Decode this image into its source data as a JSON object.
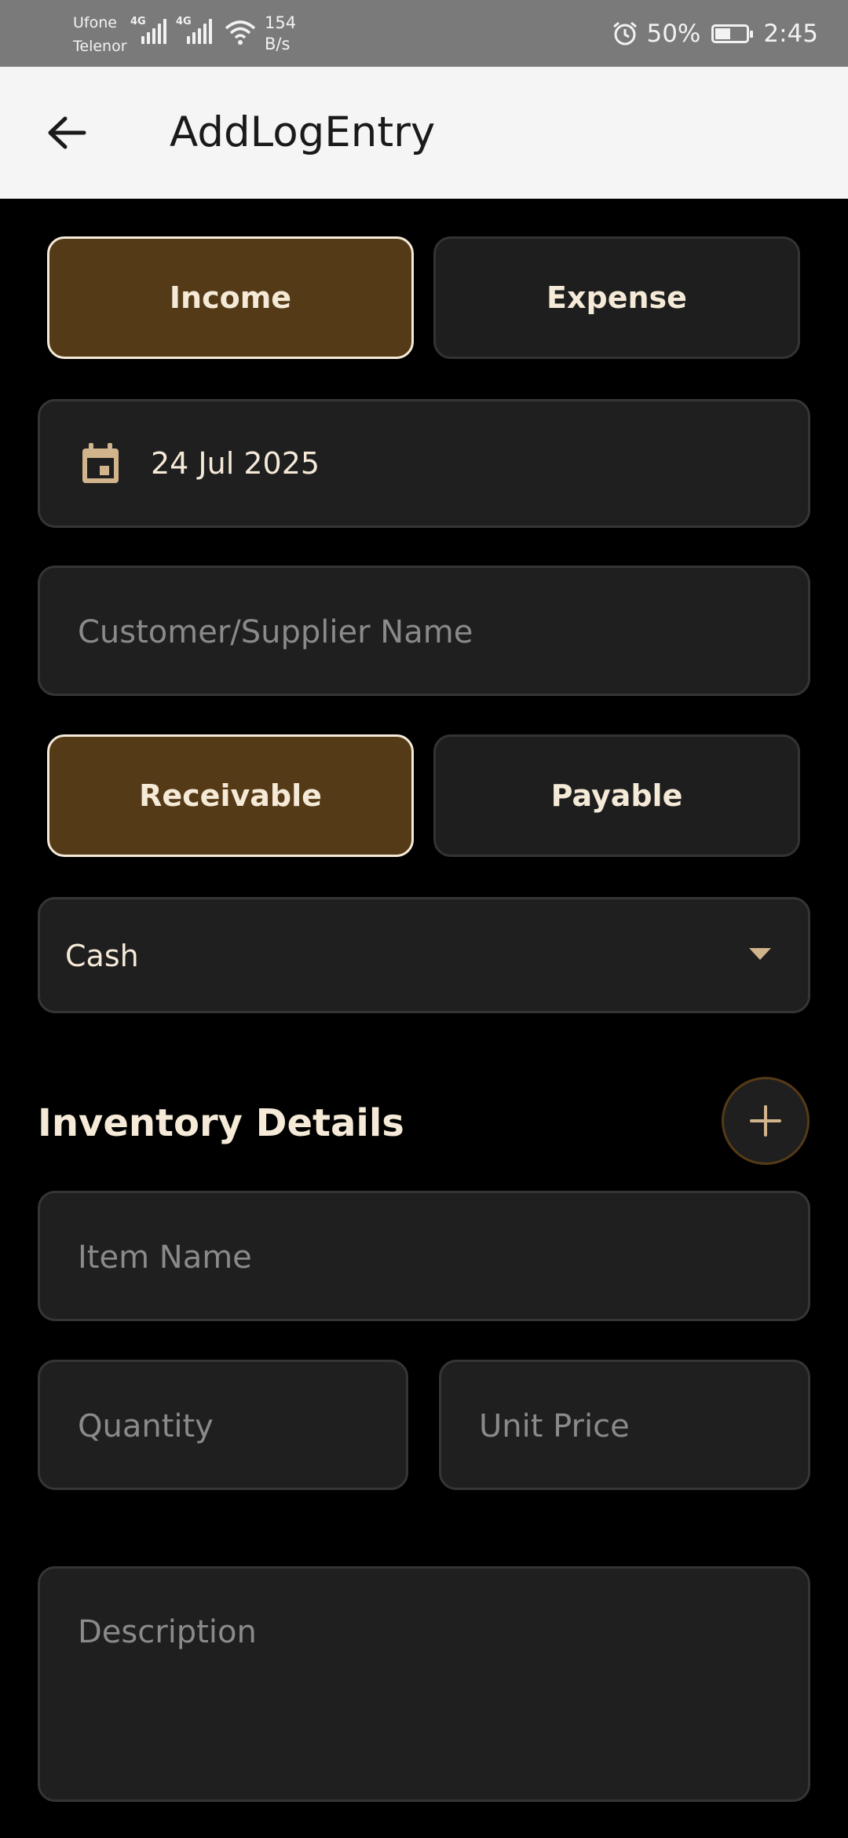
{
  "status_bar": {
    "carrier_1": "Ufone",
    "carrier_2": "Telenor",
    "network_1": "4G",
    "network_2": "4G",
    "speed_value": "154",
    "speed_unit": "B/s",
    "battery": "50%",
    "time": "2:45",
    "battery_level": 0.5
  },
  "app_bar": {
    "title": "AddLogEntry",
    "back_icon": "arrow-left-icon"
  },
  "entry_type": {
    "income_label": "Income",
    "expense_label": "Expense",
    "selected": "Income"
  },
  "date_field": {
    "icon": "calendar-icon",
    "value": "24 Jul 2025"
  },
  "party_field": {
    "placeholder": "Customer/Supplier Name"
  },
  "balance_type": {
    "receivable_label": "Receivable",
    "payable_label": "Payable",
    "selected": "Receivable"
  },
  "payment_method": {
    "selected": "Cash",
    "icon": "dropdown-arrow-icon"
  },
  "inventory": {
    "title": "Inventory Details",
    "add_icon": "plus-icon",
    "item_placeholder": "Item Name",
    "quantity_placeholder": "Quantity",
    "unit_price_placeholder": "Unit Price"
  },
  "description_field": {
    "placeholder": "Description"
  },
  "colors": {
    "background": "#000000",
    "accent_brown": "#553a17",
    "accent_tan": "#d2b48c",
    "text_cream": "#f5ead8",
    "field_bg": "#1f1f1f"
  }
}
